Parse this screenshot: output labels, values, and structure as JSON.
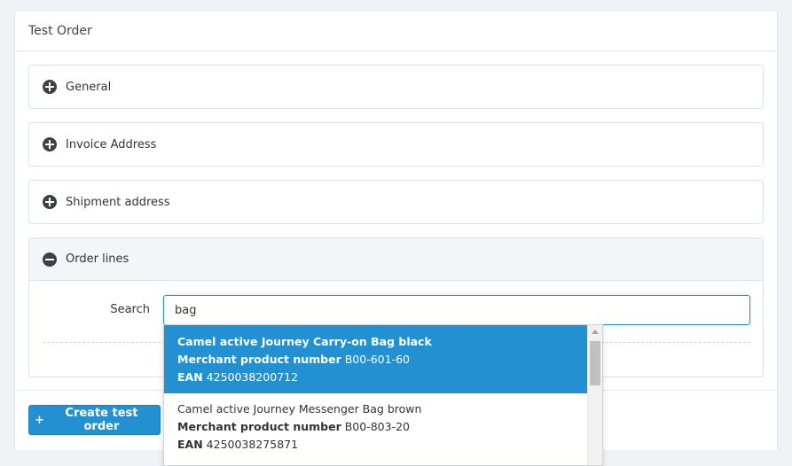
{
  "panel": {
    "title": "Test Order"
  },
  "sections": {
    "general": {
      "label": "General"
    },
    "invoice": {
      "label": "Invoice Address"
    },
    "shipment": {
      "label": "Shipment address"
    },
    "order_lines": {
      "label": "Order lines"
    }
  },
  "search": {
    "label": "Search",
    "value": "bag"
  },
  "results": [
    {
      "name": "Camel active Journey Carry-on Bag black",
      "mpn_label": "Merchant product number",
      "mpn": "B00-601-60",
      "ean_label": "EAN",
      "ean": "4250038200712"
    },
    {
      "name": "Camel active Journey Messenger Bag brown",
      "mpn_label": "Merchant product number",
      "mpn": "B00-803-20",
      "ean_label": "EAN",
      "ean": "4250038275871"
    }
  ],
  "footer": {
    "create_label": "Create test order",
    "create_icon": "plus-icon"
  },
  "colors": {
    "accent": "#2391d1",
    "icon_dark": "#3d4146",
    "section_head_bg": "#f3f6f8"
  }
}
